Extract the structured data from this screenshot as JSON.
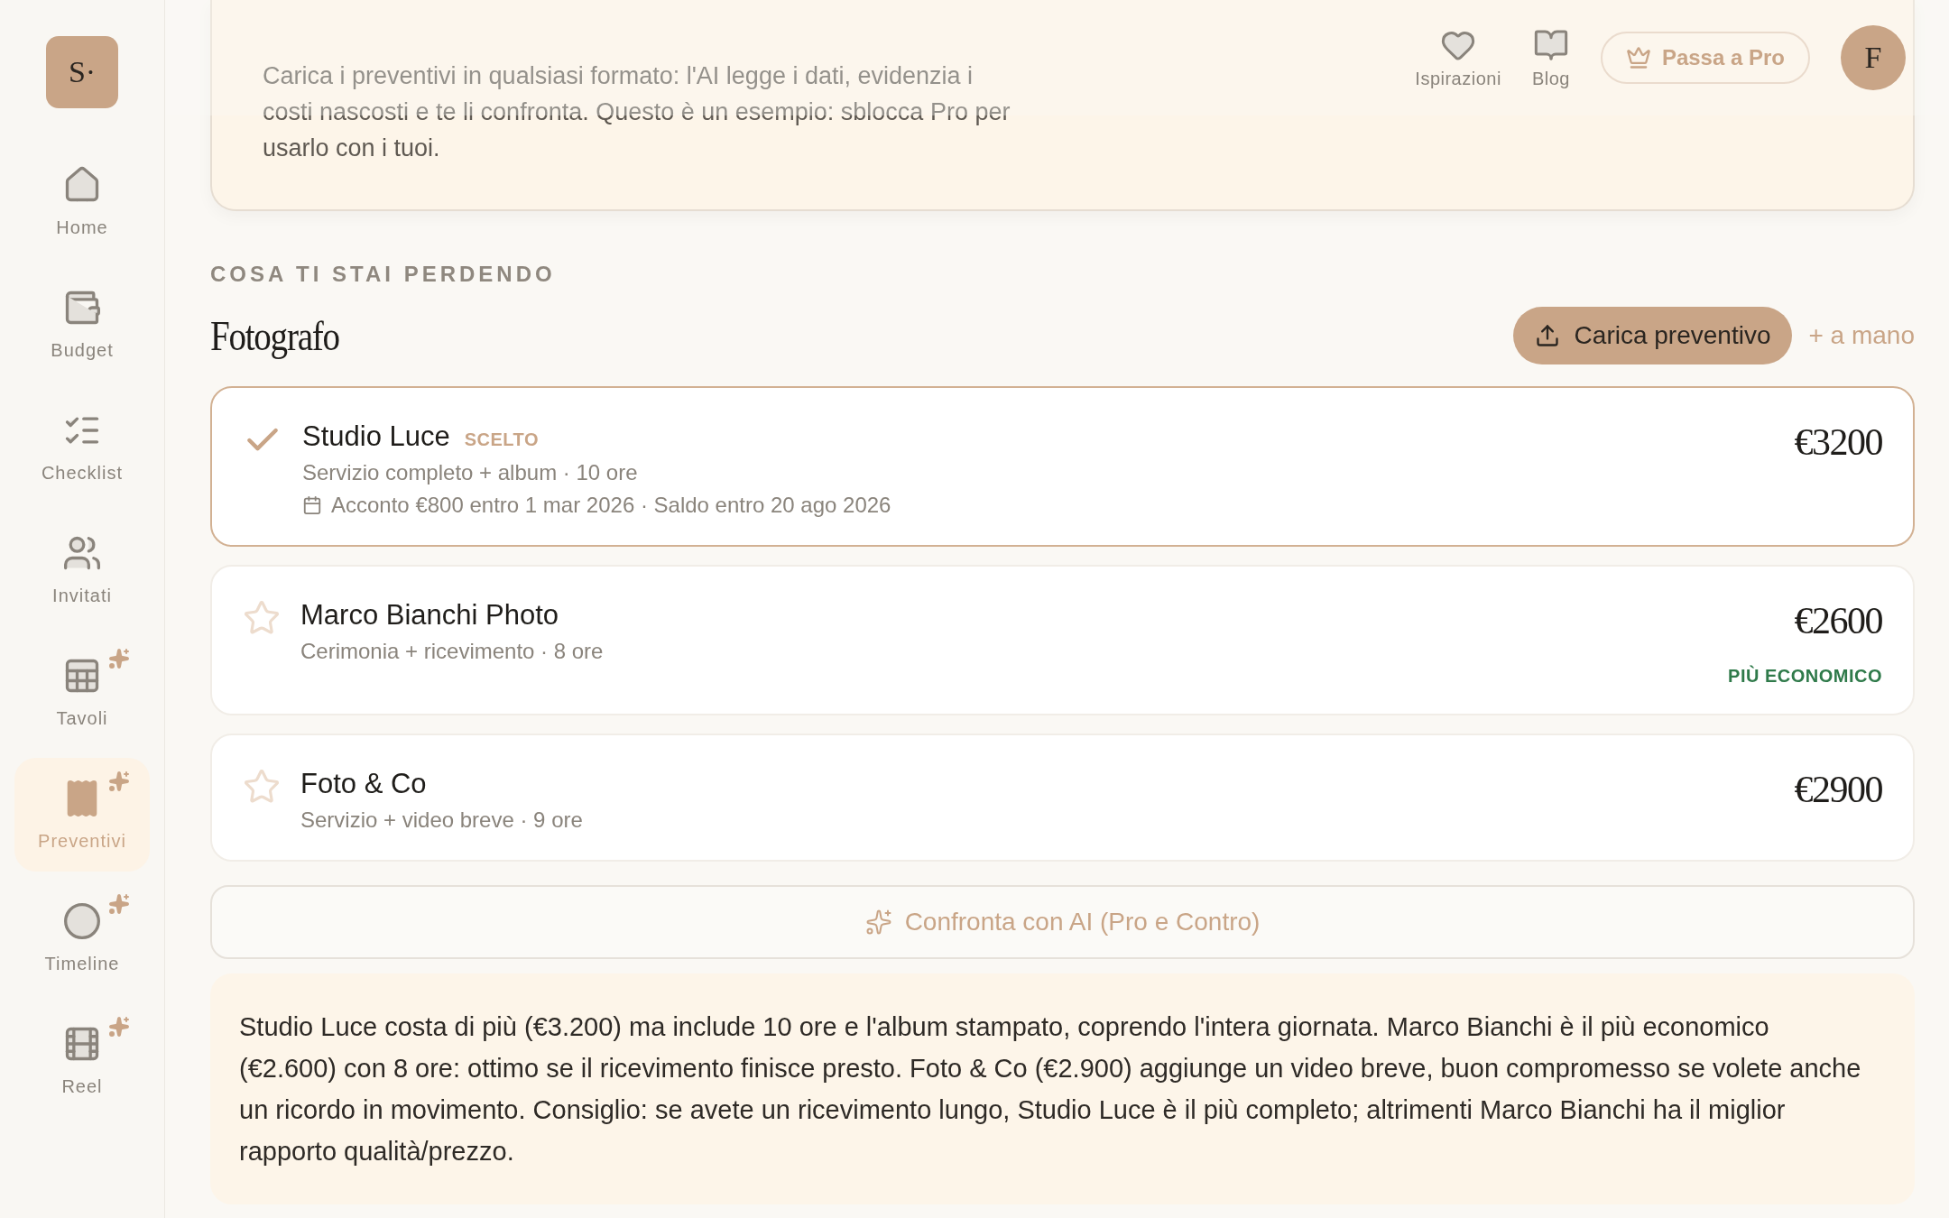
{
  "sidebar": {
    "logo": "S·",
    "items": [
      {
        "label": "Home",
        "selected": false,
        "sparkle": false
      },
      {
        "label": "Budget",
        "selected": false,
        "sparkle": false
      },
      {
        "label": "Checklist",
        "selected": false,
        "sparkle": false
      },
      {
        "label": "Invitati",
        "selected": false,
        "sparkle": false
      },
      {
        "label": "Tavoli",
        "selected": false,
        "sparkle": true
      },
      {
        "label": "Preventivi",
        "selected": true,
        "sparkle": true
      },
      {
        "label": "Timeline",
        "selected": false,
        "sparkle": true
      },
      {
        "label": "Reel",
        "selected": false,
        "sparkle": true
      }
    ]
  },
  "header": {
    "links": [
      {
        "label": "Ispirazioni"
      },
      {
        "label": "Blog"
      }
    ],
    "pro_button": "Passa a Pro",
    "avatar": "F"
  },
  "intro": {
    "text": "Carica i preventivi in qualsiasi formato: l'AI legge i dati, evidenzia i costi nascosti e te li confronta. Questo è un esempio: sblocca Pro per usarlo con i tuoi."
  },
  "section_label": "COSA TI STAI PERDENDO",
  "category": {
    "title": "Fotografo",
    "upload_button": "Carica preventivo",
    "manual_link": "+ a mano"
  },
  "quotes": [
    {
      "name": "Studio Luce",
      "selected": true,
      "badge": "SCELTO",
      "details": "Servizio completo + album · 10 ore",
      "payment": "Acconto €800 entro 1 mar 2026 · Saldo entro 20 ago 2026",
      "price": "€3200"
    },
    {
      "name": "Marco Bianchi Photo",
      "selected": false,
      "details": "Cerimonia + ricevimento · 8 ore",
      "price": "€2600",
      "tag": "PIÙ ECONOMICO"
    },
    {
      "name": "Foto & Co",
      "selected": false,
      "details": "Servizio + video breve · 9 ore",
      "price": "€2900"
    }
  ],
  "compare_button": "Confronta con AI (Pro e Contro)",
  "summary": "Studio Luce costa di più (€3.200) ma include 10 ore e l'album stampato, coprendo l'intera giornata. Marco Bianchi è il più economico (€2.600) con 8 ore: ottimo se il ricevimento finisce presto. Foto & Co (€2.900) aggiunge un video breve, buon compromesso se volete anche un ricordo in movimento. Consiglio: se avete un ricevimento lungo, Studio Luce è il più completo; altrimenti Marco Bianchi ha il miglior rapporto qualità/prezzo."
}
